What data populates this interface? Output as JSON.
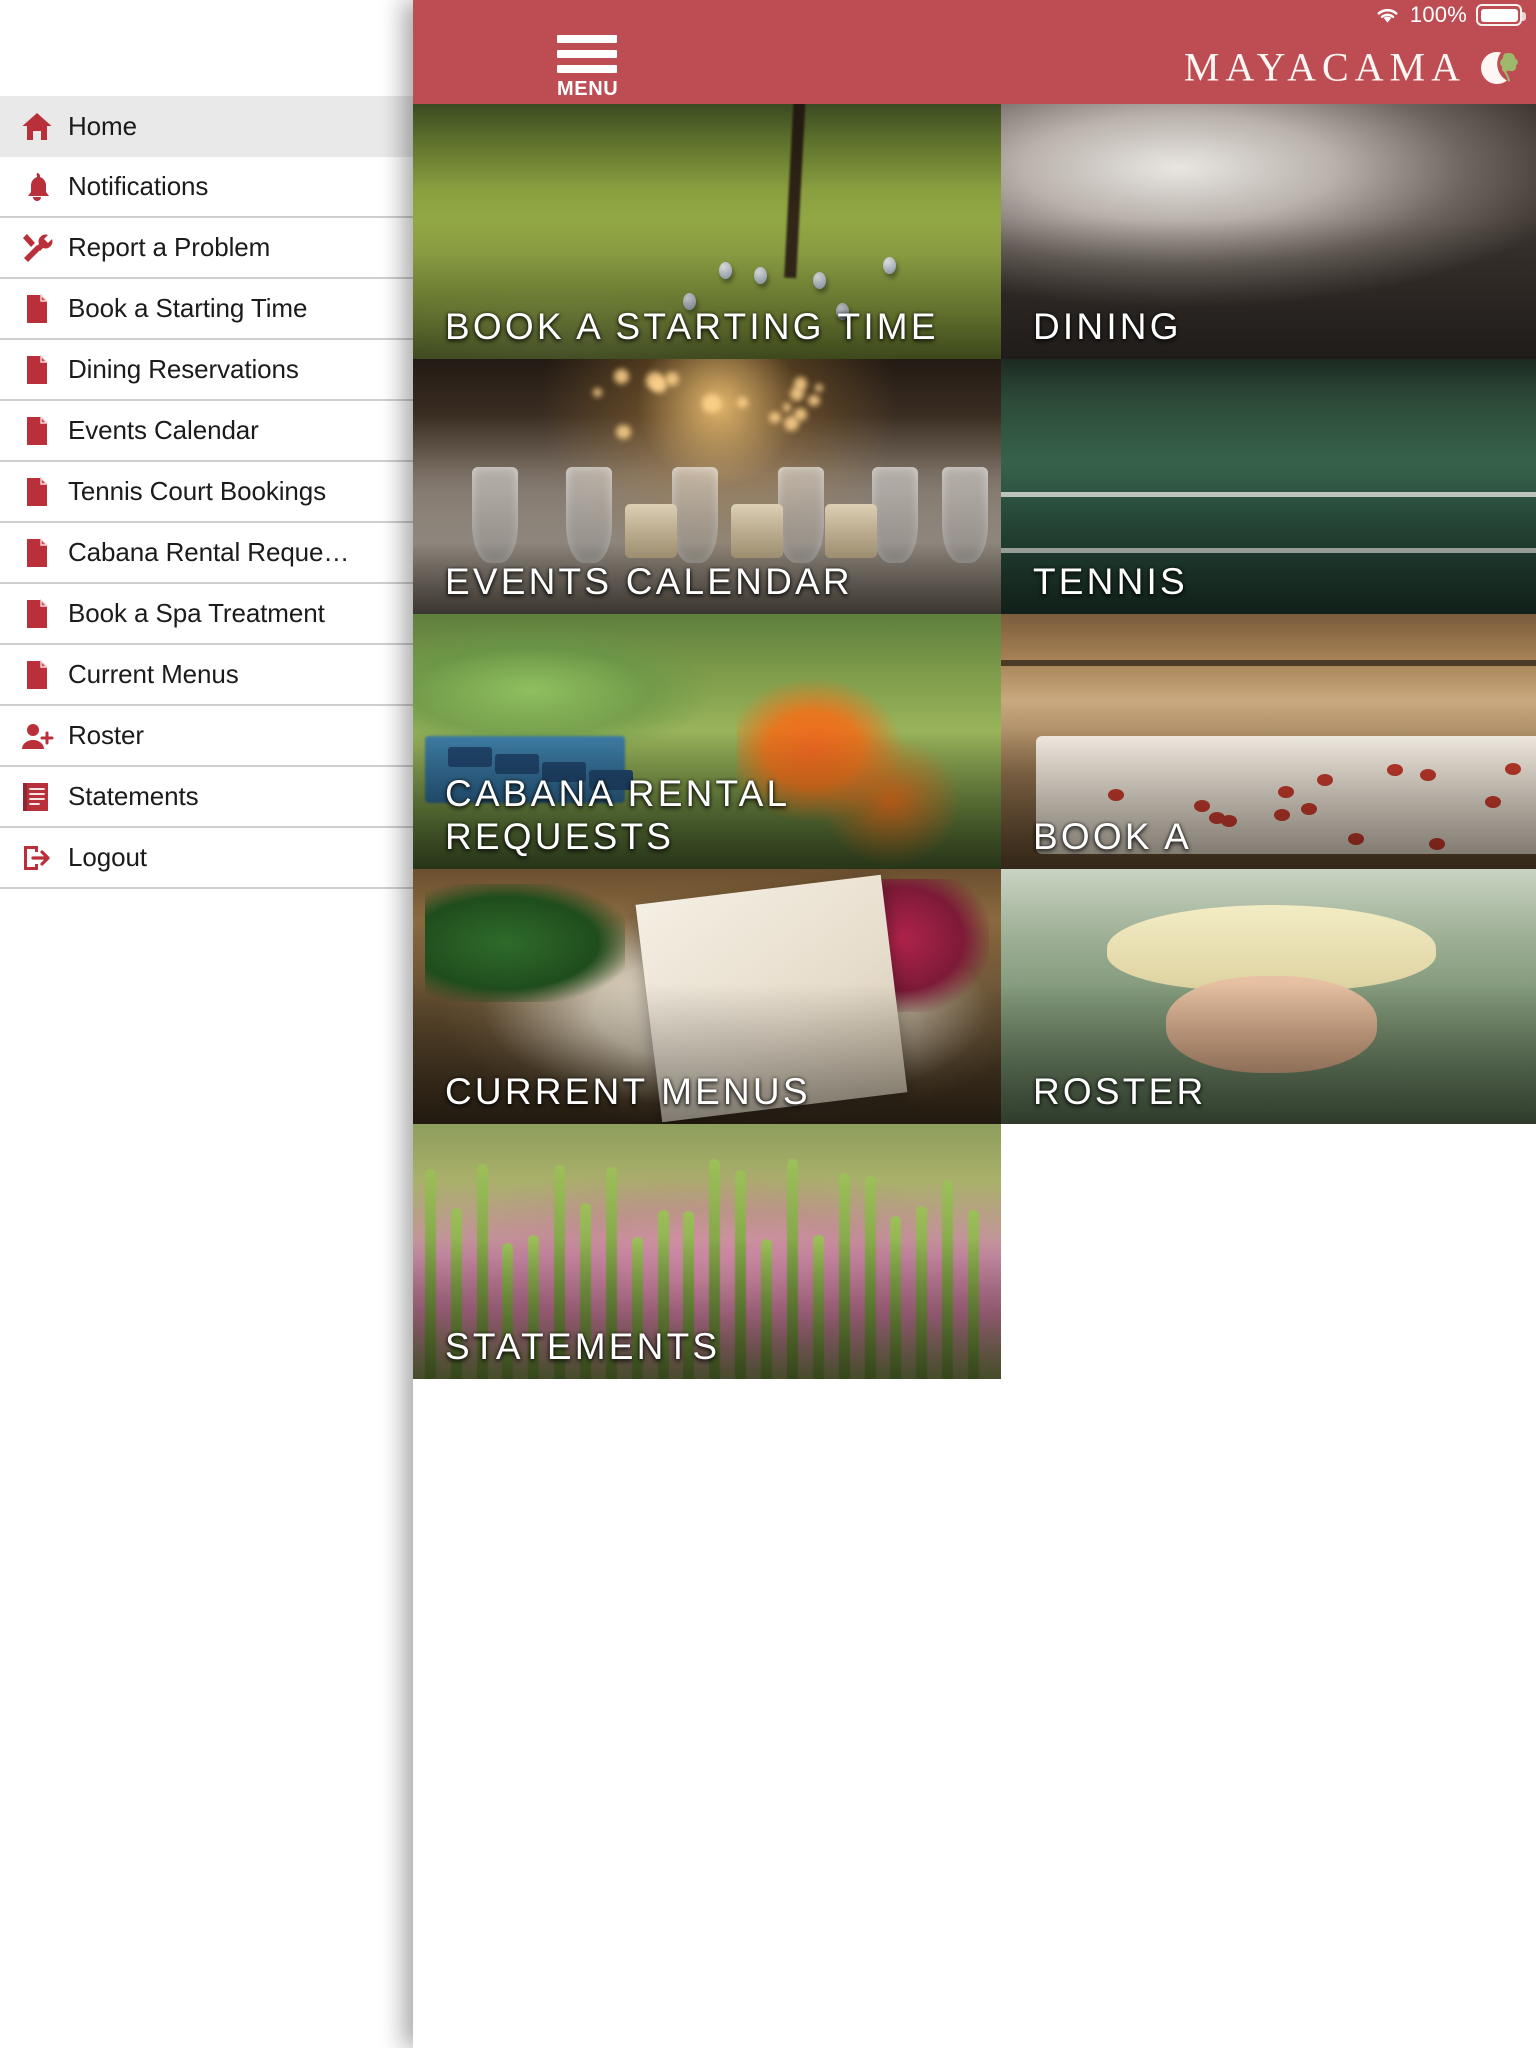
{
  "status_bar": {
    "wifi_icon": "wifi-icon",
    "battery_percent": "100%",
    "battery_icon": "battery-full-icon"
  },
  "header": {
    "menu_icon": "hamburger-menu-icon",
    "menu_label": "MENU",
    "brand_name": "MAYACAMA",
    "brand_emblem_icon": "moon-grape-leaf-emblem-icon",
    "background_color": "#bd4d53"
  },
  "sidebar": {
    "items": [
      {
        "label": "Home",
        "icon": "home-icon",
        "active": true
      },
      {
        "label": "Notifications",
        "icon": "bell-icon",
        "active": false
      },
      {
        "label": "Report a Problem",
        "icon": "tools-icon",
        "active": false
      },
      {
        "label": "Book a Starting Time",
        "icon": "document-icon",
        "active": false
      },
      {
        "label": "Dining Reservations",
        "icon": "document-icon",
        "active": false
      },
      {
        "label": "Events Calendar",
        "icon": "document-icon",
        "active": false
      },
      {
        "label": "Tennis Court Bookings",
        "icon": "document-icon",
        "active": false
      },
      {
        "label": "Cabana Rental Reque…",
        "icon": "document-icon",
        "active": false
      },
      {
        "label": "Book a Spa Treatment",
        "icon": "document-icon",
        "active": false
      },
      {
        "label": "Current Menus",
        "icon": "document-icon",
        "active": false
      },
      {
        "label": "Roster",
        "icon": "person-add-icon",
        "active": false
      },
      {
        "label": "Statements",
        "icon": "statement-list-icon",
        "active": false
      },
      {
        "label": "Logout",
        "icon": "logout-icon",
        "active": false
      }
    ],
    "icon_color": "#b9303a",
    "active_background": "#e9e9e9"
  },
  "tiles": [
    {
      "caption": "BOOK A STARTING TIME",
      "scene": "sc-golf",
      "col": "left"
    },
    {
      "caption": "DINING",
      "scene": "sc-dining",
      "col": "right"
    },
    {
      "caption": "EVENTS CALENDAR",
      "scene": "sc-events",
      "col": "left"
    },
    {
      "caption": "TENNIS",
      "scene": "sc-tennis",
      "col": "right"
    },
    {
      "caption": "CABANA RENTAL REQUESTS",
      "scene": "sc-cabana",
      "col": "left"
    },
    {
      "caption": "BOOK A",
      "scene": "sc-spa",
      "col": "right"
    },
    {
      "caption": "CURRENT MENUS",
      "scene": "sc-menus",
      "col": "left"
    },
    {
      "caption": "ROSTER",
      "scene": "sc-roster",
      "col": "right"
    },
    {
      "caption": "STATEMENTS",
      "scene": "sc-stmt",
      "col": "left"
    }
  ]
}
